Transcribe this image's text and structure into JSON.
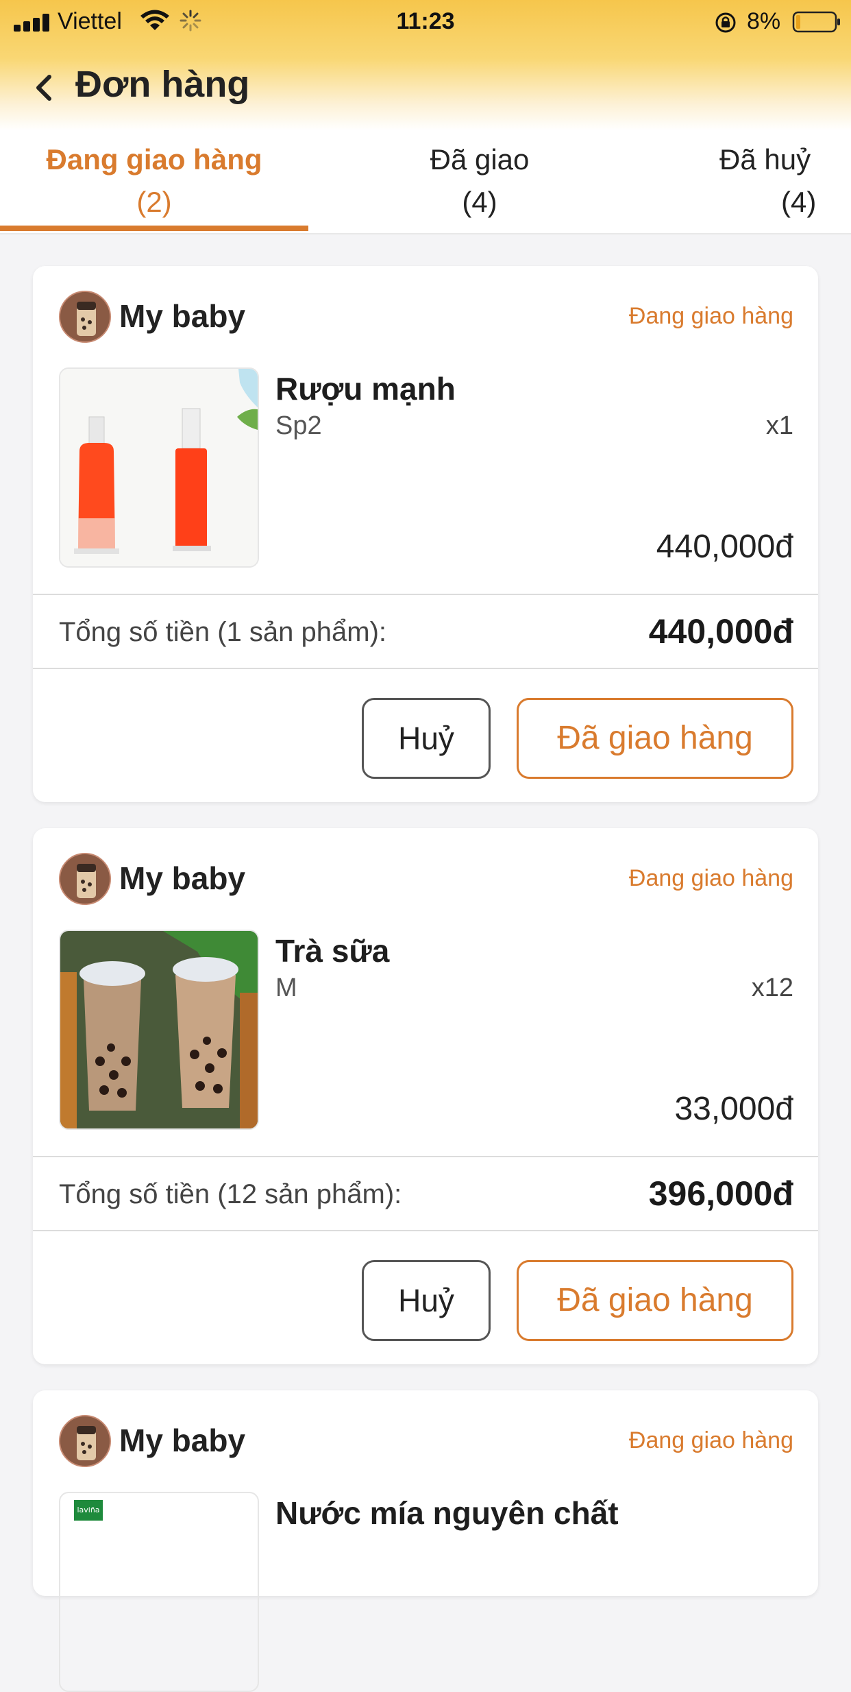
{
  "status_bar": {
    "carrier": "Viettel",
    "time": "11:23",
    "battery_percent": "8%"
  },
  "nav": {
    "title": "Đơn hàng"
  },
  "tabs": [
    {
      "label": "Đang giao hàng",
      "count": "(2)",
      "active": true
    },
    {
      "label": "Đã giao",
      "count": "(4)",
      "active": false
    },
    {
      "label": "Đã huỷ",
      "count": "(4)",
      "active": false
    }
  ],
  "orders": [
    {
      "shop_name": "My baby",
      "status": "Đang giao hàng",
      "product": {
        "name": "Rượu mạnh",
        "variant": "Sp2",
        "qty": "x1",
        "price": "440,000đ"
      },
      "total_label": "Tổng số tiền (1 sản phẩm):",
      "total_amount": "440,000đ",
      "cancel_label": "Huỷ",
      "delivered_label": "Đã giao hàng"
    },
    {
      "shop_name": "My baby",
      "status": "Đang giao hàng",
      "product": {
        "name": "Trà sữa",
        "variant": "M",
        "qty": "x12",
        "price": "33,000đ"
      },
      "total_label": "Tổng số tiền (12 sản phẩm):",
      "total_amount": "396,000đ",
      "cancel_label": "Huỷ",
      "delivered_label": "Đã giao hàng"
    },
    {
      "shop_name": "My baby",
      "status": "Đang giao hàng",
      "product": {
        "name": "Nước mía nguyên chất",
        "image_badge": "laviña"
      }
    }
  ],
  "colors": {
    "accent": "#d97b2e",
    "header_gradient_top": "#f6c64c",
    "background": "#f4f4f6"
  },
  "icons": [
    "signal-icon",
    "wifi-icon",
    "spinner-icon",
    "lock-rotation-icon",
    "battery-icon",
    "back-icon"
  ]
}
